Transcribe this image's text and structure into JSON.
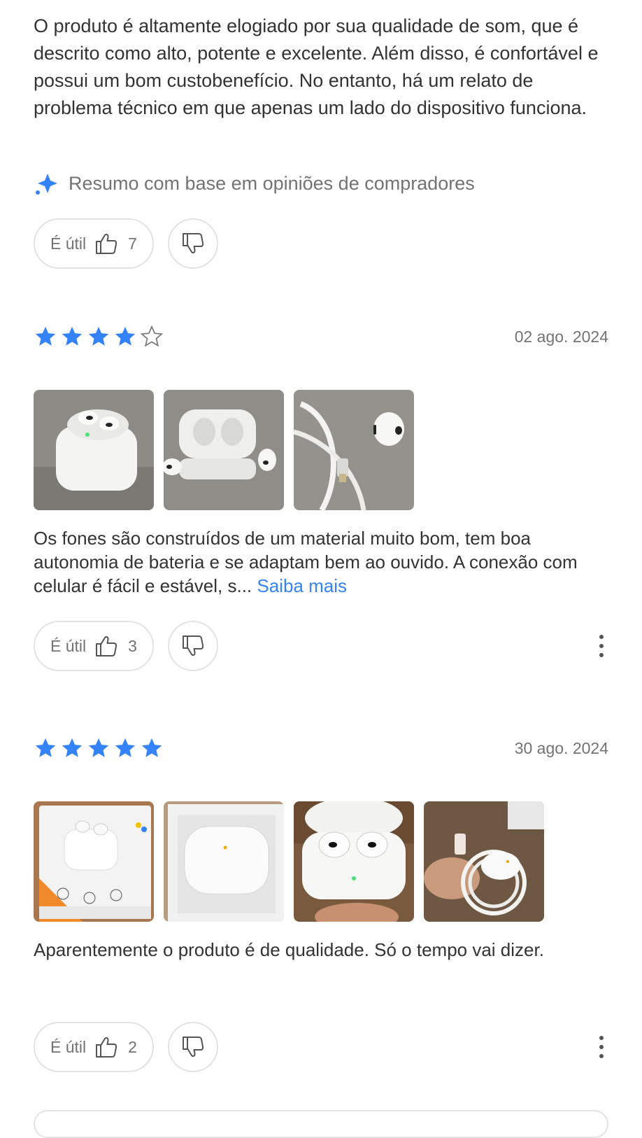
{
  "summary": {
    "text": "O produto é altamente elogiado por sua qualidade de som, que é descrito como alto, potente e excelente. Além disso, é confortável e possui um bom custobenefício. No entanto, há um relato de problema técnico em que apenas um lado do dispositivo funciona.",
    "note": "Resumo com base em opiniões de compradores",
    "note_icon": "sparkle-icon",
    "useful_label": "É útil",
    "useful_count": "7"
  },
  "reviews": [
    {
      "rating": 4,
      "rating_max": 5,
      "date": "02 ago. 2024",
      "photo_count": 3,
      "text": "Os fones são construídos de um material muito bom, tem boa autonomia de bateria e se adaptam bem ao ouvido. A conexão com celular é fácil e estável, s...",
      "more_label": "Saiba mais",
      "useful_label": "É útil",
      "useful_count": "3"
    },
    {
      "rating": 5,
      "rating_max": 5,
      "date": "30 ago. 2024",
      "photo_count": 4,
      "text": "Aparentemente o produto é de qualidade. Só o tempo vai dizer.",
      "useful_label": "É útil",
      "useful_count": "2"
    }
  ],
  "colors": {
    "star": "#3483fa",
    "link": "#3483fa",
    "text": "#333333",
    "muted": "#737373",
    "border": "#e3e3e3"
  }
}
